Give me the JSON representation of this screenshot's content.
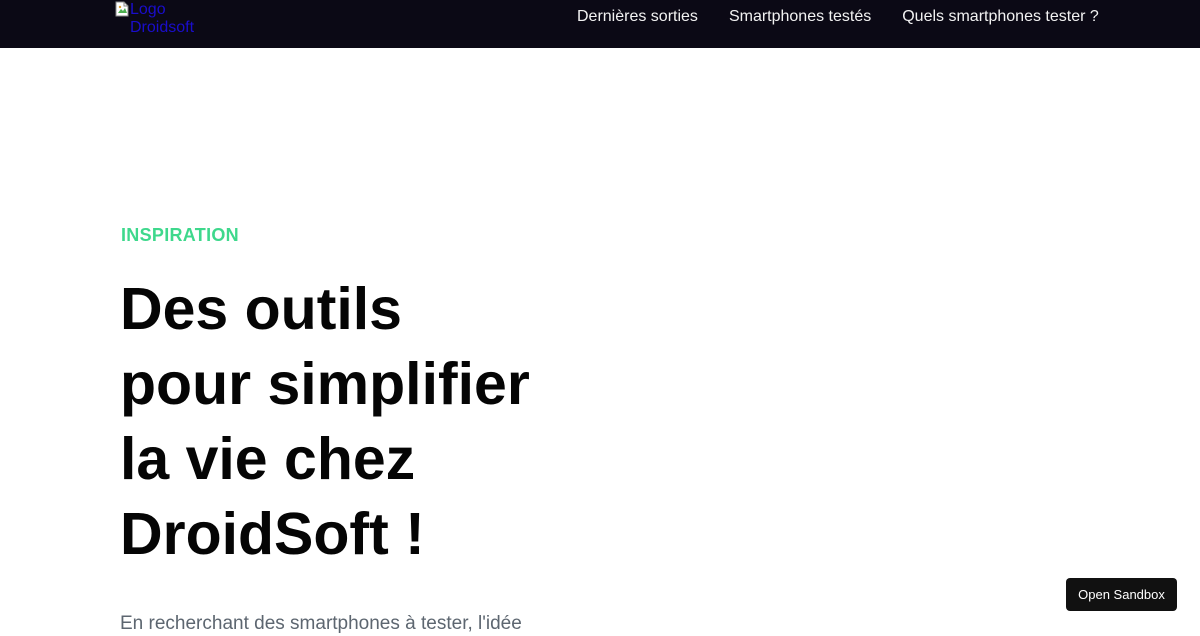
{
  "header": {
    "logo": {
      "alt_text": "Logo Droidsoft",
      "icon": "broken-image-icon"
    },
    "nav": [
      {
        "label": "Dernières sorties"
      },
      {
        "label": "Smartphones testés"
      },
      {
        "label": "Quels smartphones tester ?"
      }
    ]
  },
  "hero": {
    "eyebrow": "INSPIRATION",
    "title_lines": [
      "Des outils",
      "pour simplifier",
      "la vie chez",
      "DroidSoft !"
    ],
    "intro": "En recherchant des smartphones à tester, l'idée"
  },
  "sandbox_button": {
    "label": "Open Sandbox"
  },
  "colors": {
    "navbar_bg": "#0b0915",
    "nav_text": "#f2f2f2",
    "accent": "#3ed88c",
    "title": "#050505",
    "body_text": "#5d6670",
    "link": "#1a0dcc",
    "button_bg": "#111111"
  }
}
